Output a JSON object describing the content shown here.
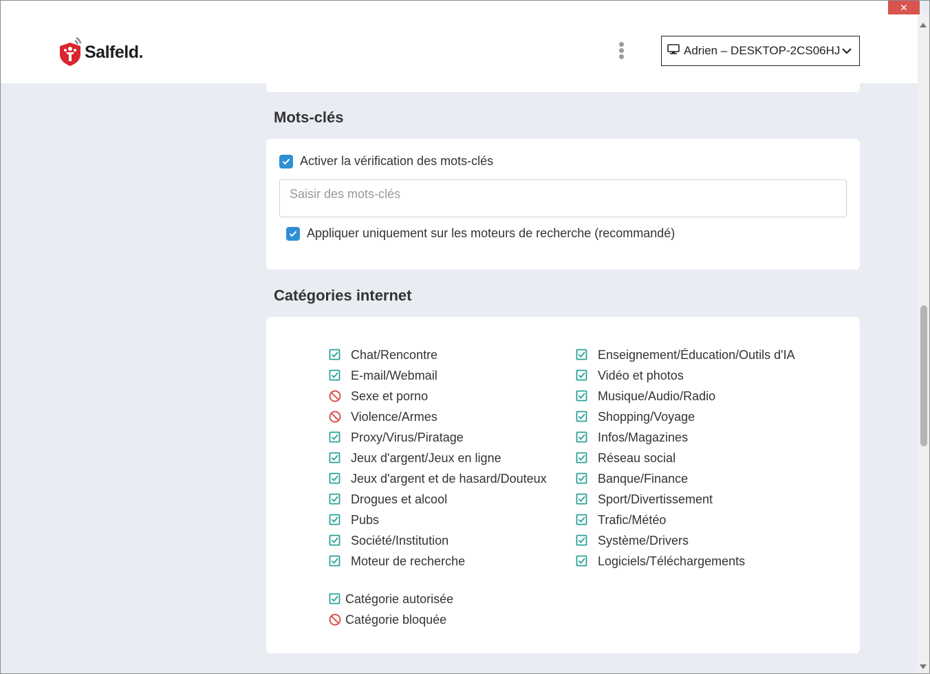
{
  "window": {
    "close_label": "✕"
  },
  "header": {
    "brand": "Salfeld.",
    "device_label": "Adrien – DESKTOP-2CS06HJ"
  },
  "keywords": {
    "title": "Mots-clés",
    "enable_label": "Activer la vérification des mots-clés",
    "enable_checked": true,
    "input_placeholder": "Saisir des mots-clés",
    "input_value": "",
    "search_only_label": "Appliquer uniquement sur les moteurs de recherche (recommandé)",
    "search_only_checked": true
  },
  "categories": {
    "title": "Catégories internet",
    "left": [
      {
        "label": "Chat/Rencontre",
        "status": "allowed"
      },
      {
        "label": "E-mail/Webmail",
        "status": "allowed"
      },
      {
        "label": "Sexe et porno",
        "status": "blocked"
      },
      {
        "label": "Violence/Armes",
        "status": "blocked"
      },
      {
        "label": "Proxy/Virus/Piratage",
        "status": "allowed"
      },
      {
        "label": "Jeux d'argent/Jeux en ligne",
        "status": "allowed"
      },
      {
        "label": "Jeux d'argent et de hasard/Douteux",
        "status": "allowed"
      },
      {
        "label": "Drogues et alcool",
        "status": "allowed"
      },
      {
        "label": "Pubs",
        "status": "allowed"
      },
      {
        "label": "Société/Institution",
        "status": "allowed"
      },
      {
        "label": "Moteur de recherche",
        "status": "allowed"
      }
    ],
    "right": [
      {
        "label": "Enseignement/Éducation/Outils d'IA",
        "status": "allowed"
      },
      {
        "label": "Vidéo et photos",
        "status": "allowed"
      },
      {
        "label": "Musique/Audio/Radio",
        "status": "allowed"
      },
      {
        "label": "Shopping/Voyage",
        "status": "allowed"
      },
      {
        "label": "Infos/Magazines",
        "status": "allowed"
      },
      {
        "label": "Réseau social",
        "status": "allowed"
      },
      {
        "label": "Banque/Finance",
        "status": "allowed"
      },
      {
        "label": "Sport/Divertissement",
        "status": "allowed"
      },
      {
        "label": "Trafic/Météo",
        "status": "allowed"
      },
      {
        "label": "Système/Drivers",
        "status": "allowed"
      },
      {
        "label": "Logiciels/Téléchargements",
        "status": "allowed"
      }
    ],
    "legend": {
      "allowed_label": "Catégorie autorisée",
      "blocked_label": "Catégorie bloquée"
    }
  },
  "colors": {
    "allowed": "#2aa198",
    "blocked": "#d9534f",
    "checkbox": "#2f8fd5",
    "brand_red": "#d9262e"
  }
}
